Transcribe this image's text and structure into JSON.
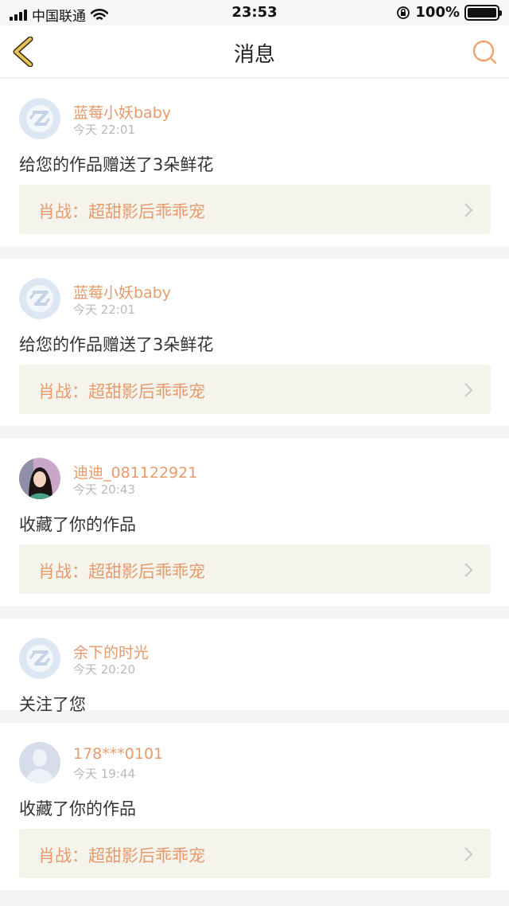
{
  "status_bar": {
    "carrier": "中国联通",
    "time": "23:53",
    "battery": "100%",
    "battery_level": 1.0
  },
  "nav": {
    "title": "消息"
  },
  "colors": {
    "accent": "#e79a6b",
    "back_icon": "#d8b24a",
    "work_bg": "#f5f4ec"
  },
  "messages": [
    {
      "name": "蓝莓小妖baby",
      "time": "今天 22:01",
      "action": "给您的作品赠送了3朵鲜花",
      "work": "肖战：超甜影后乖乖宠",
      "avatar": "default-logo-avatar"
    },
    {
      "name": "蓝莓小妖baby",
      "time": "今天 22:01",
      "action": "给您的作品赠送了3朵鲜花",
      "work": "肖战：超甜影后乖乖宠",
      "avatar": "default-logo-avatar"
    },
    {
      "name": "迪迪_081122921",
      "time": "今天 20:43",
      "action": "收藏了你的作品",
      "work": "肖战：超甜影后乖乖宠",
      "avatar": "photo-avatar"
    },
    {
      "name": "余下的时光",
      "time": "今天 20:20",
      "action": "关注了您",
      "avatar": "default-logo-avatar"
    },
    {
      "name": "178***0101",
      "time": "今天 19:44",
      "action": "收藏了你的作品",
      "work": "肖战：超甜影后乖乖宠",
      "avatar": "silhouette-avatar"
    }
  ]
}
